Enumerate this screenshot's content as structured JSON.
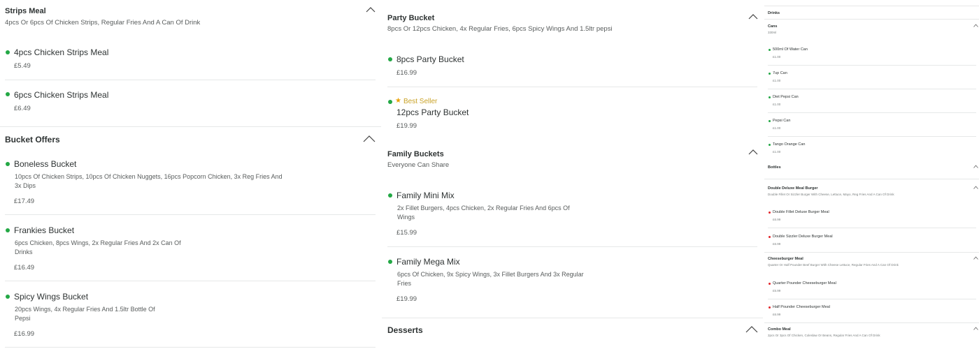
{
  "col1": {
    "strips": {
      "title": "Strips Meal",
      "subtitle": "4pcs Or 6pcs Of Chicken Strips, Regular Fries And A Can Of Drink",
      "items": [
        {
          "name": "4pcs Chicken Strips Meal",
          "price": "£5.49"
        },
        {
          "name": "6pcs Chicken Strips Meal",
          "price": "£6.49"
        }
      ]
    },
    "bucket_offers": {
      "title": "Bucket Offers",
      "items": [
        {
          "name": "Boneless Bucket",
          "desc1": "10pcs Of Chicken Strips, 10pcs Of Chicken Nuggets, 16pcs Popcorn Chicken, 3x Reg Fries And",
          "desc2": "3x Dips",
          "price": "£17.49"
        },
        {
          "name": "Frankies Bucket",
          "desc1": "6pcs Chicken, 8pcs Wings, 2x Regular Fries And 2x Can Of",
          "desc2": "Drinks",
          "price": "£16.49"
        },
        {
          "name": "Spicy Wings Bucket",
          "desc1": "20pcs Wings, 4x Regular Fries And 1.5ltr Bottle Of",
          "desc2": "Pepsi",
          "price": "£16.99"
        }
      ]
    }
  },
  "col2": {
    "party": {
      "title": "Party Bucket",
      "subtitle": "8pcs Or 12pcs Chicken, 4x Regular Fries, 6pcs Spicy Wings And 1.5ltr pepsi",
      "items": [
        {
          "name": "8pcs Party Bucket",
          "price": "£16.99"
        },
        {
          "badge": "Best Seller",
          "name": "12pcs Party Bucket",
          "price": "£19.99"
        }
      ]
    },
    "family": {
      "title": "Family Buckets",
      "subtitle": "Everyone Can Share",
      "items": [
        {
          "name": "Family Mini Mix",
          "desc1": "2x Fillet Burgers, 4pcs Chicken, 2x Regular Fries And 6pcs Of",
          "desc2": "Wings",
          "price": "£15.99"
        },
        {
          "name": "Family Mega Mix",
          "desc1": "6pcs Of Chicken, 9x Spicy Wings, 3x Fillet Burgers And 3x Regular",
          "desc2": "Fries",
          "price": "£19.99"
        }
      ]
    },
    "desserts": {
      "title": "Desserts"
    }
  },
  "col3": {
    "drinks_title": "Drinks",
    "cans": {
      "title": "Cans",
      "subtitle": "330ml",
      "items": [
        {
          "name": "500ml Of Water Can",
          "price": "£1.00"
        },
        {
          "name": "7up Can",
          "price": "£1.00"
        },
        {
          "name": "Diet Pepsi Can",
          "price": "£1.00"
        },
        {
          "name": "Pepsi Can",
          "price": "£1.00"
        },
        {
          "name": "Tango Orange Can",
          "price": "£1.00"
        }
      ]
    },
    "bottles": {
      "title": "Bottles"
    },
    "double_deluxe": {
      "title": "Double Deluxe Meal Burger",
      "subtitle": "Double Fillet Or Sizzler Burger With Cheese, Lettuce, Mayo, Reg Fries And A Can Of Drink",
      "items": [
        {
          "name": "Double Fillet Deluxe Burger Meal",
          "price": "£6.99"
        },
        {
          "name": "Double Sizzler Deluxe Burger Meal",
          "price": "£6.99"
        }
      ]
    },
    "cheeseburger": {
      "title": "Cheeseburger Meal",
      "subtitle": "Quarter Or Half Pounder Beef Burger With Cheese Lettuce, Regular Fries And A Can Of Drink",
      "items": [
        {
          "name": "Quarter Pounder Cheeseburger Meal",
          "price": "£5.99"
        },
        {
          "name": "Half Pounder Cheeseburger Meal",
          "price": "£6.99"
        }
      ]
    },
    "combo": {
      "title": "Combo Meal",
      "subtitle": "2pcs Or 3pcs Of Chicken, Coleslaw Or Beans, Regular Fries And A Can Of Drink"
    }
  },
  "colors": {
    "veg_green": "#23a845",
    "red_dot": "#e2262b",
    "badge_gold": "#c9a227",
    "text": "#2e3333",
    "muted": "#585c5c"
  }
}
